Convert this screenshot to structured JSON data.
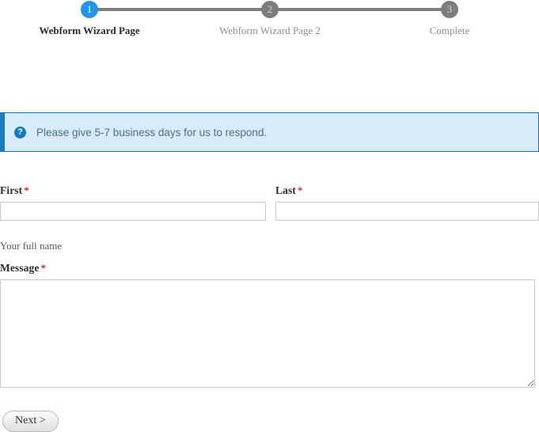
{
  "wizard": {
    "steps": [
      {
        "number": "1",
        "label": "Webform Wizard Page",
        "state": "active"
      },
      {
        "number": "2",
        "label": "Webform Wizard Page 2",
        "state": "inactive"
      },
      {
        "number": "3",
        "label": "Complete",
        "state": "inactive"
      }
    ],
    "active_color": "#2196e8",
    "inactive_color": "#7d7d7d",
    "connector_color": "#7d7d7d"
  },
  "message": {
    "icon": "question-mark-circle-icon",
    "text": "Please give 5-7 business days for us to respond.",
    "background": "#d7ecf8",
    "border_color": "#0c74b5",
    "accent_color": "#1b7cba",
    "text_color": "#4a6f89"
  },
  "form": {
    "required_marker": "*",
    "required_color": "#e81e1e",
    "first": {
      "label": "First",
      "value": "",
      "placeholder": "",
      "required": "*"
    },
    "last": {
      "label": "Last",
      "value": "",
      "placeholder": "",
      "required": "*"
    },
    "name_help": "Your full name",
    "message": {
      "label": "Message",
      "value": "",
      "placeholder": "",
      "required": "*"
    }
  },
  "actions": {
    "next_label": "Next >"
  }
}
